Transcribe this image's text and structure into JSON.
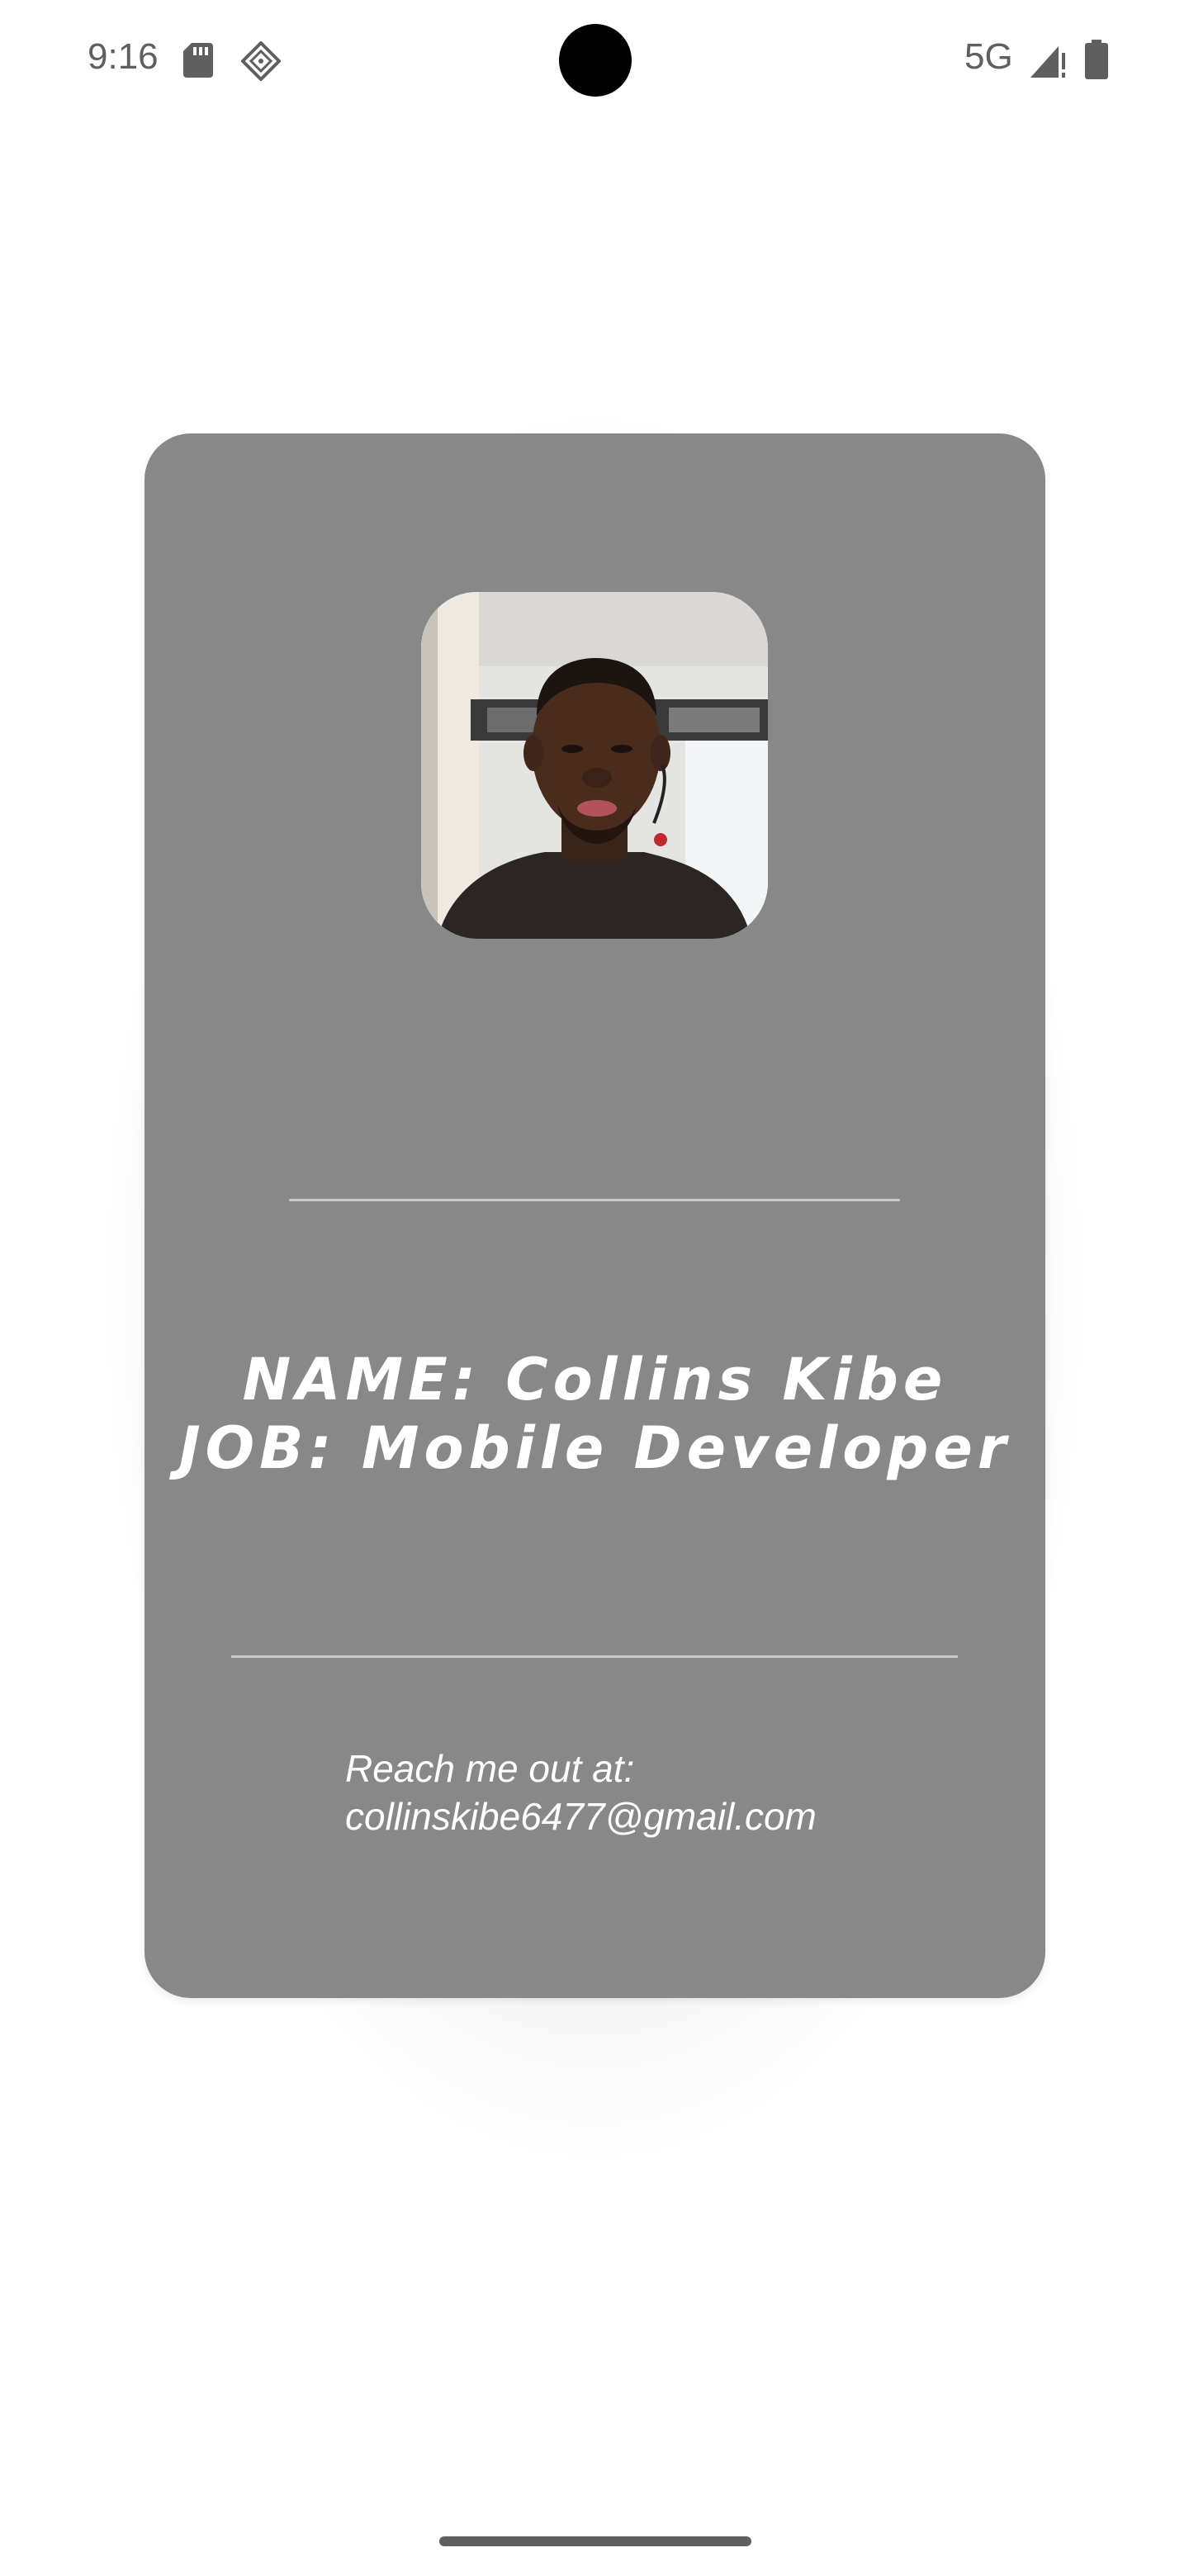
{
  "status_bar": {
    "time": "9:16",
    "network": "5G",
    "icons": [
      "sd-card-icon",
      "app-notification-icon",
      "signal-icon",
      "battery-icon"
    ]
  },
  "card": {
    "background_color": "#888888",
    "name_text": "NAME: Collins Kibe",
    "job_text": "JOB: Mobile Developer",
    "contact_label": "Reach me out at:",
    "contact_email": "collinskibe6477@gmail.com"
  }
}
